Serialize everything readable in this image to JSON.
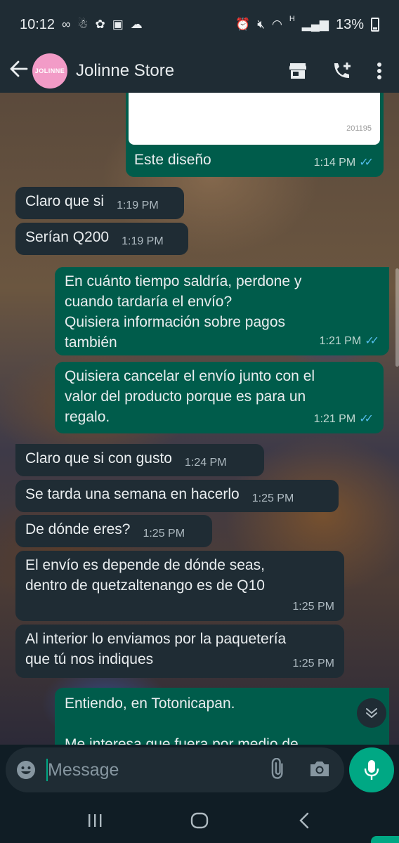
{
  "status_bar": {
    "time": "10:12",
    "battery_percent": "13%",
    "network": "H"
  },
  "header": {
    "contact_name": "Jolinne Store",
    "avatar_text": "JOLINNE"
  },
  "image_message": {
    "code": "201195",
    "caption": "Este diseño",
    "time": "1:14 PM"
  },
  "messages": [
    {
      "direction": "in",
      "text": "Claro que si",
      "time": "1:19 PM"
    },
    {
      "direction": "in",
      "text": "Serían Q200",
      "time": "1:19 PM"
    },
    {
      "direction": "out",
      "lines": [
        "En cuánto tiempo saldría, perdone y",
        "cuando tardaría el envío?",
        "Quisiera información sobre pagos",
        "también"
      ],
      "time": "1:21 PM"
    },
    {
      "direction": "out",
      "lines": [
        "Quisiera cancelar el envío junto con el",
        "valor del producto porque es para un",
        "regalo."
      ],
      "time": "1:21 PM"
    },
    {
      "direction": "in",
      "text": "Claro que si con gusto",
      "time": "1:24 PM"
    },
    {
      "direction": "in",
      "text": "Se tarda una semana en hacerlo",
      "time": "1:25 PM"
    },
    {
      "direction": "in",
      "text": "De dónde eres?",
      "time": "1:25 PM"
    },
    {
      "direction": "in",
      "lines": [
        "El envío es depende de dónde seas,",
        "dentro de quetzaltenango es de Q10"
      ],
      "time": "1:25 PM"
    },
    {
      "direction": "in",
      "lines": [
        "Al interior lo enviamos por la paquetería",
        "que tú nos indiques"
      ],
      "time": "1:25 PM"
    },
    {
      "direction": "out",
      "lines": [
        "Entiendo, en Totonicapan.",
        "",
        "Me interesa que fuera por medio de"
      ]
    }
  ],
  "input": {
    "placeholder": "Message"
  },
  "colors": {
    "incoming_bubble": "#1f2c34",
    "outgoing_bubble": "#005c4b",
    "accent": "#00a884",
    "read_ticks": "#53bdeb"
  }
}
